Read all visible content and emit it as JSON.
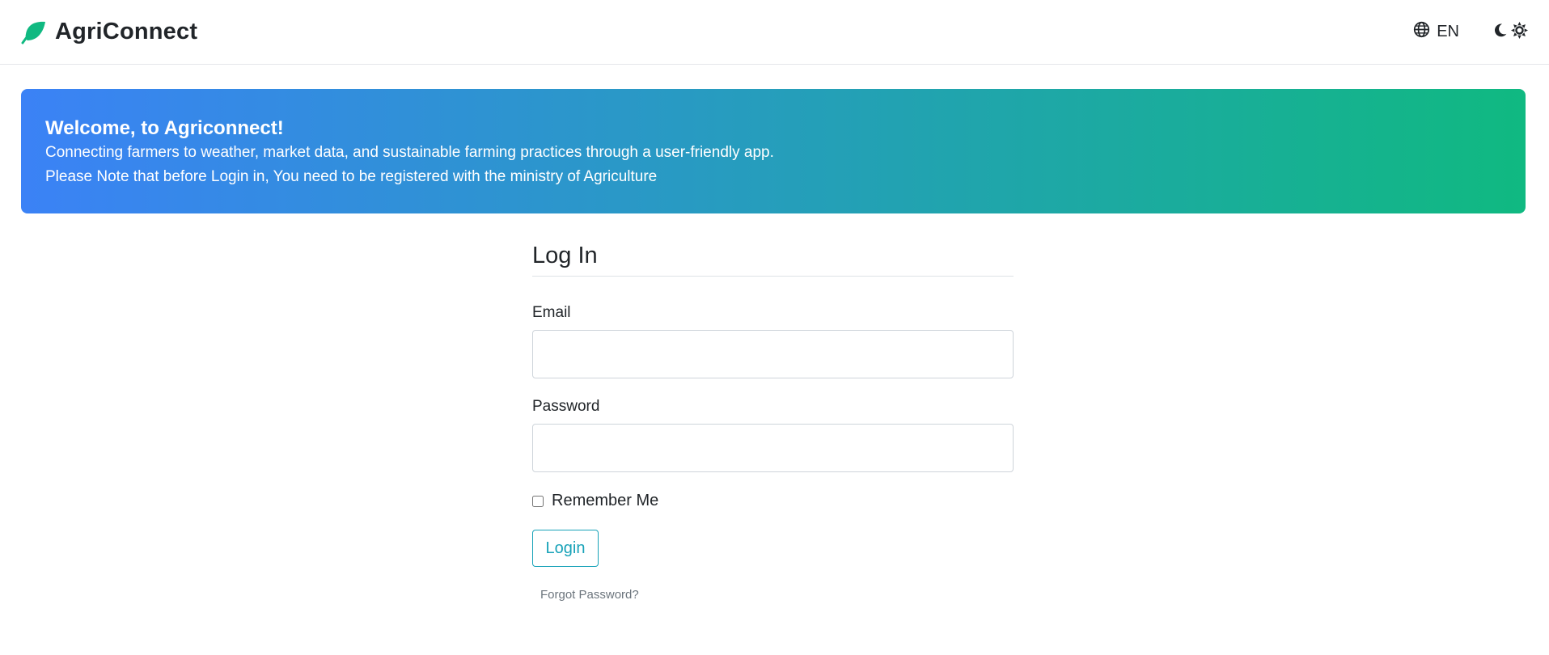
{
  "brand": {
    "name": "AgriConnect",
    "icon": "leaf-icon",
    "color": "#10b981"
  },
  "nav": {
    "language_label": "EN",
    "language_icon": "globe-icon",
    "theme_icons": [
      "moon-icon",
      "sun-icon"
    ]
  },
  "hero": {
    "title": "Welcome, to Agriconnect!",
    "line1": "Connecting farmers to weather, market data, and sustainable farming practices through a user-friendly app.",
    "line2": "Please Note that before Login in, You need to be registered with the ministry of Agriculture",
    "gradient_start": "#3b82f6",
    "gradient_end": "#10b981"
  },
  "login": {
    "title": "Log In",
    "email_label": "Email",
    "email_value": "",
    "password_label": "Password",
    "password_value": "",
    "remember_label": "Remember Me",
    "remember_checked": false,
    "button_label": "Login",
    "forgot_label": "Forgot Password?",
    "accent": "#17a2b8"
  }
}
